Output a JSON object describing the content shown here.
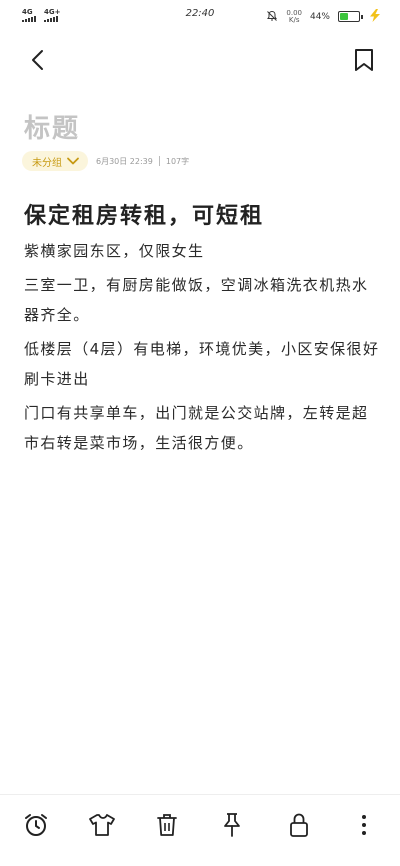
{
  "status_bar": {
    "sim1_label": "4G",
    "sim2_label": "4G+",
    "time": "22:40",
    "mute_icon": "bell-off-icon",
    "speed_top": "0.00",
    "speed_bottom": "K/s",
    "battery_percent": "44%",
    "battery_level": 0.44,
    "charging_icon": "lightning-icon"
  },
  "nav": {
    "back_icon": "chevron-left-icon",
    "bookmark_icon": "bookmark-icon"
  },
  "note": {
    "title_placeholder": "标题",
    "folder_label": "未分组",
    "date_time": "6月30日 22:39",
    "char_count": "107字",
    "heading": "保定租房转租，可短租",
    "paragraphs": [
      "紫横家园东区，仅限女生",
      "三室一卫，有厨房能做饭，空调冰箱洗衣机热水器齐全。",
      "低楼层（4层）有电梯，环境优美，小区安保很好刷卡进出",
      "门口有共享单车，出门就是公交站牌，左转是超市右转是菜市场，生活很方便。"
    ]
  },
  "toolbar": {
    "items": [
      "alarm-clock-icon",
      "shirt-icon",
      "trash-icon",
      "pin-icon",
      "lock-icon",
      "more-vertical-icon"
    ]
  },
  "colors": {
    "accent": "#c79a12",
    "chip_bg": "#fbf5dc",
    "battery_fill": "#3cc43c",
    "charge_bolt": "#f2c21b"
  }
}
